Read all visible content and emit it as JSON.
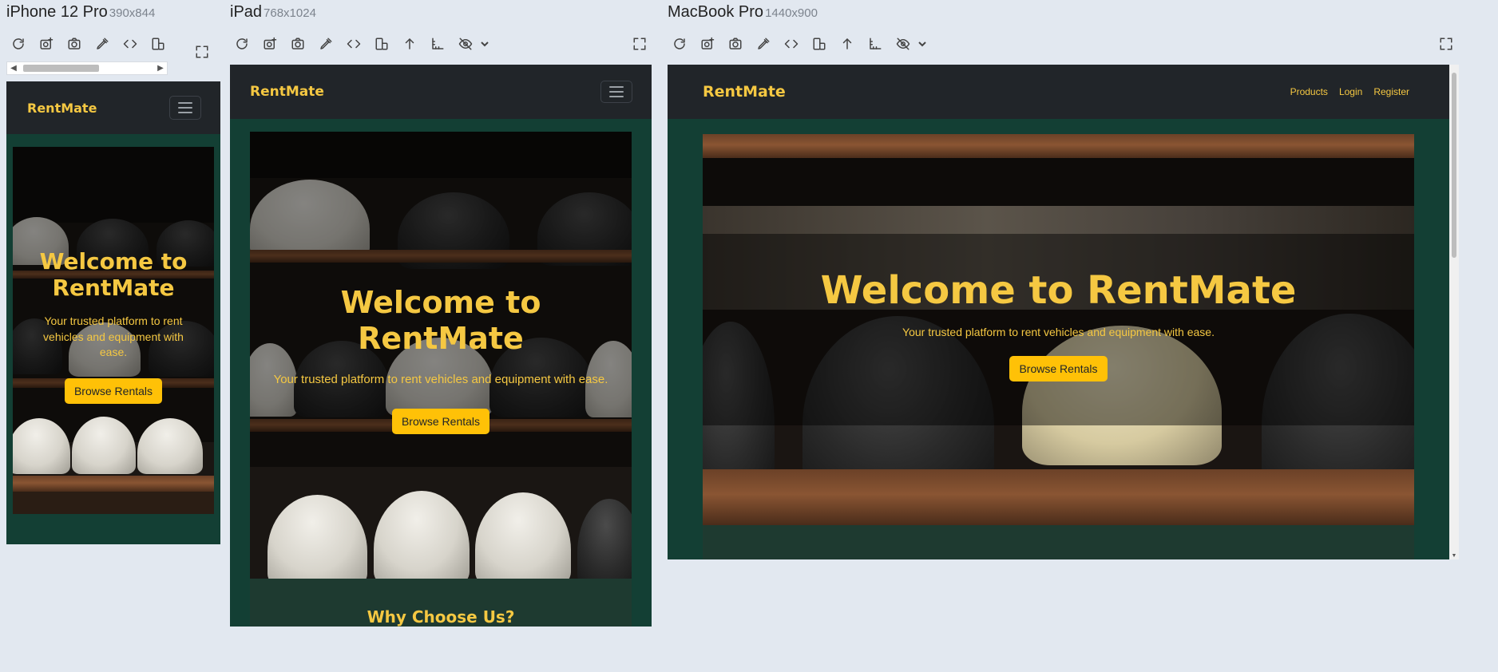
{
  "devices": [
    {
      "name": "iPhone 12 Pro",
      "size": "390x844"
    },
    {
      "name": "iPad",
      "size": "768x1024"
    },
    {
      "name": "MacBook Pro",
      "size": "1440x900"
    }
  ],
  "toolbar_icons": [
    "reload-icon",
    "screenshot-viewport-icon",
    "camera-icon",
    "color-picker-icon",
    "code-icon",
    "rotate-device-icon",
    "scroll-to-top-icon",
    "ruler-icon",
    "hide-icon"
  ],
  "site": {
    "brand": "RentMate",
    "nav_links": [
      "Products",
      "Login",
      "Register"
    ],
    "hero_title": "Welcome to RentMate",
    "hero_subtitle": "Your trusted platform to rent vehicles and equipment with ease.",
    "cta_label": "Browse Rentals",
    "section_title": "Why Choose Us?"
  },
  "colors": {
    "page_bg": "#e2e8f0",
    "nav_bg": "#212529",
    "site_bg": "#133f34",
    "accent_yellow": "#f5c842",
    "button_yellow": "#ffc107"
  }
}
